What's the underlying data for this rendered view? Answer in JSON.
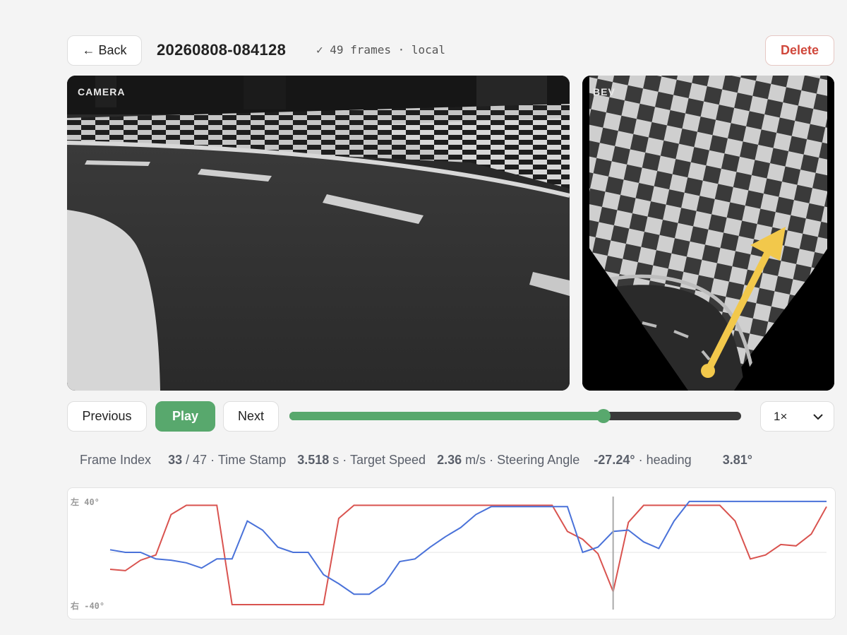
{
  "header": {
    "back_label": "← Back",
    "title": "20260808-084128",
    "meta": "✓ 49 frames · local",
    "delete_label": "Delete"
  },
  "camera": {
    "label": "CAMERA"
  },
  "bev": {
    "label": "BEV"
  },
  "controls": {
    "previous_label": "Previous",
    "play_label": "Play",
    "next_label": "Next",
    "progress_fraction": 0.696,
    "speed_value": "1×"
  },
  "stats": {
    "frame_index_label": "Frame Index",
    "frame_index_value": "33",
    "frame_total": "/ 47 ·",
    "time_stamp_label": "Time Stamp",
    "time_stamp_value": "3.518",
    "time_stamp_unit": "s ·",
    "target_speed_label": "Target Speed",
    "target_speed_value": "2.36",
    "target_speed_unit": "m/s ·",
    "steering_angle_label": "Steering Angle",
    "steering_angle_value": "-27.24°",
    "steering_angle_sep": "·",
    "heading_label": "heading",
    "heading_value": "3.81°"
  },
  "chart_data": {
    "type": "line",
    "ylim": [
      -40,
      40
    ],
    "y_tick_labels": {
      "top": "左 40°",
      "bottom": "右 -40°"
    },
    "current_frame": 33,
    "colors": {
      "red": "#d9534f",
      "blue": "#4a72d9"
    },
    "series": [
      {
        "color": "red",
        "values": [
          -13,
          -14,
          -6,
          -2,
          29,
          36,
          36,
          36,
          -40,
          -40,
          -40,
          -40,
          -40,
          -40,
          -40,
          26,
          36,
          36,
          36,
          36,
          36,
          36,
          36,
          36,
          36,
          36,
          36,
          36,
          36,
          36,
          16,
          10,
          -1,
          -30,
          23,
          36,
          36,
          36,
          36,
          36,
          36,
          24,
          -5,
          -2,
          6,
          5,
          14,
          35
        ]
      },
      {
        "color": "blue",
        "values": [
          2,
          0,
          0,
          -5,
          -6,
          -8,
          -12,
          -5,
          -5,
          24,
          17,
          4,
          0,
          0,
          -17,
          -24,
          -32,
          -32,
          -24,
          -7,
          -5,
          4,
          12,
          19,
          29,
          35,
          35,
          35,
          35,
          35,
          35,
          0,
          4,
          16,
          17,
          8,
          3,
          24,
          39,
          39,
          39,
          39,
          39,
          39,
          39,
          39,
          39,
          39
        ]
      }
    ]
  }
}
